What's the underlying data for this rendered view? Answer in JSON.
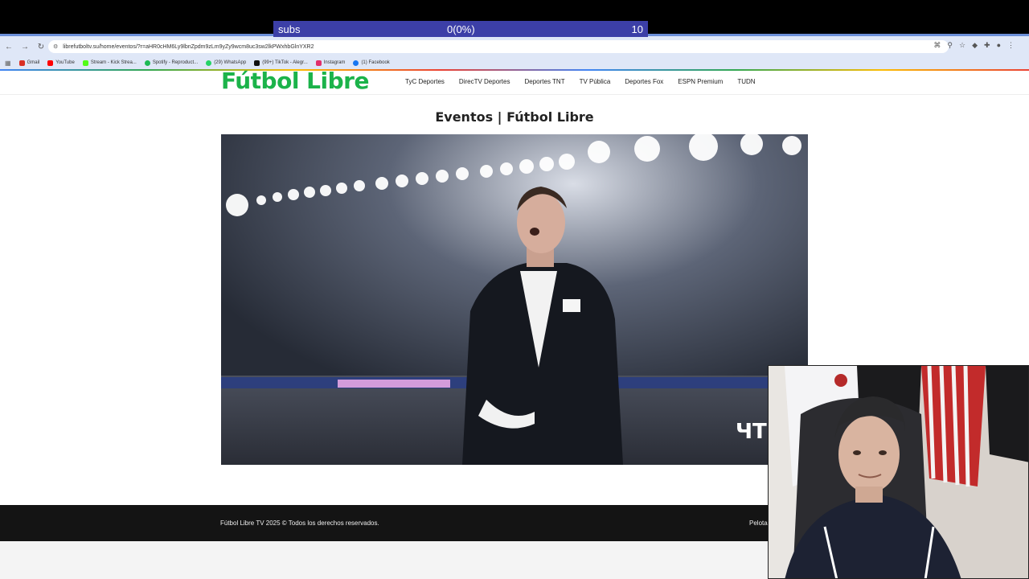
{
  "overlay": {
    "label": "subs",
    "value": "0(0%)",
    "goal": "10"
  },
  "browser": {
    "url": "librefutboltv.su/home/eventos/?r=aHR0cHM6Ly9lbnZpdm9zLm9yZy9wcm8uc3sw2lkPWxhbGlnYXR2",
    "bookmarks": [
      {
        "label": "Gmail",
        "color": "#d93025"
      },
      {
        "label": "YouTube",
        "color": "#ff0000"
      },
      {
        "label": "Stream - Kick Strea...",
        "color": "#53fc18"
      },
      {
        "label": "Spotify - Reproduct...",
        "color": "#1db954"
      },
      {
        "label": "(29) WhatsApp",
        "color": "#25d366"
      },
      {
        "label": "(99+) TikTok - Alegr...",
        "color": "#111111"
      },
      {
        "label": "Instagram",
        "color": "#e1306c"
      },
      {
        "label": "(1) Facebook",
        "color": "#1877f2"
      }
    ]
  },
  "site": {
    "logo": "Fútbol Libre",
    "brand_color": "#1bb34a",
    "nav": [
      "TyC Deportes",
      "DirecTV Deportes",
      "Deportes TNT",
      "TV Pública",
      "Deportes Fox",
      "ESPN Premium",
      "TUDN"
    ],
    "page_title": "Eventos | Fútbol Libre",
    "footer": "Fútbol Libre TV 2025 © Todos los derechos reservados.",
    "footer_right": "Pelota"
  }
}
